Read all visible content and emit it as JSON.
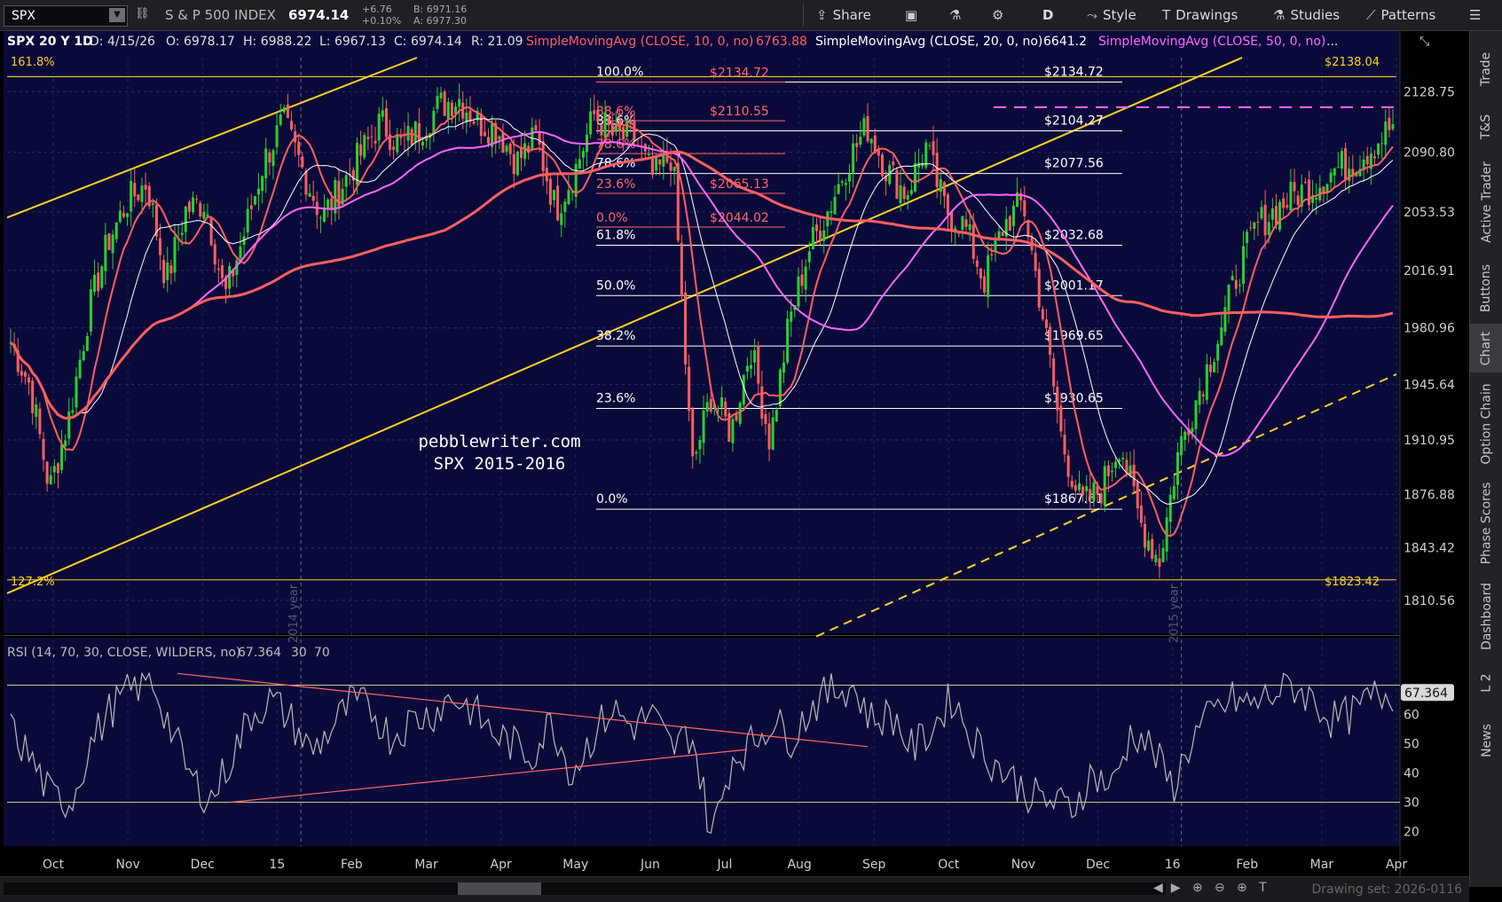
{
  "toolbar": {
    "symbol": "SPX",
    "description": "S & P 500 INDEX",
    "last": "6974.14",
    "change": "+6.76",
    "change_pct": "+0.10%",
    "bid": "B: 6971.16",
    "ask": "A: 6977.30",
    "buttons": {
      "share": "Share",
      "period": "D",
      "style": "Style",
      "drawings": "Drawings",
      "studies": "Studies",
      "patterns": "Patterns"
    }
  },
  "status_line": {
    "title": "SPX 20 Y 1D",
    "date": "D: 4/15/26",
    "open": "O: 6978.17",
    "high": "H: 6988.22",
    "low": "L: 6967.13",
    "close": "C: 6974.14",
    "range": "R: 21.09",
    "sma10_label": "SimpleMovingAvg (CLOSE, 10, 0, no)",
    "sma10_value": "6763.88",
    "sma20_label": "SimpleMovingAvg (CLOSE, 20, 0, no)",
    "sma20_value": "6641.2",
    "sma50_label": "SimpleMovingAvg (CLOSE, 50, 0, no)",
    "more": "..."
  },
  "colors": {
    "background": "#0a0a3a",
    "sma10": "#ff5f5f",
    "sma20": "#ffffff",
    "sma50": "#ff66ff",
    "sma200": "#ff5f5f",
    "channel": "#ffd21f",
    "fib_large": "#ffffff",
    "fib_small": "#ff6666",
    "rsi": "#b9b9b9",
    "up_candle": "#2bd02b",
    "down_candle": "#ff5f5f"
  },
  "chart_data": {
    "type": "candlestick",
    "title": "",
    "watermark": [
      "pebblewriter.com",
      "SPX 2015-2016"
    ],
    "ylim": [
      1790,
      2150
    ],
    "y_ticks": [
      2128.75,
      2090.8,
      2053.53,
      2016.91,
      1980.96,
      1945.64,
      1910.95,
      1876.88,
      1843.42,
      1810.56
    ],
    "x_ticks": [
      "Oct",
      "Nov",
      "Dec",
      "15",
      "Feb",
      "Mar",
      "Apr",
      "May",
      "Jun",
      "Jul",
      "Aug",
      "Sep",
      "Oct",
      "Nov",
      "Dec",
      "16",
      "Feb",
      "Mar",
      "Apr"
    ],
    "year_separators": [
      "2014 year",
      "2015 year"
    ],
    "price_path": [
      1972,
      1945,
      1880,
      1925,
      1990,
      2035,
      2060,
      2072,
      2010,
      2055,
      2060,
      2000,
      2040,
      2085,
      2110,
      2080,
      2050,
      2070,
      2090,
      2110,
      2095,
      2105,
      2120,
      2125,
      2110,
      2105,
      2085,
      2100,
      2055,
      2080,
      2115,
      2100,
      2100,
      2075,
      2090,
      1893,
      1940,
      1915,
      1970,
      1910,
      1985,
      2030,
      2055,
      2085,
      2107,
      2080,
      2065,
      2095,
      2055,
      2045,
      2010,
      2045,
      2060,
      1990,
      1910,
      1870,
      1880,
      1910,
      1860,
      1835,
      1905,
      1940,
      1975,
      2015,
      2045,
      2055,
      2065,
      2070,
      2080,
      2085,
      2095,
      2108
    ],
    "fib_levels_large": [
      {
        "pct": "100.0%",
        "price": "$2134.72"
      },
      {
        "pct": "88.6%",
        "price": "$2104.27"
      },
      {
        "pct": "78.6%",
        "price": "$2077.56"
      },
      {
        "pct": "61.8%",
        "price": "$2032.68"
      },
      {
        "pct": "50.0%",
        "price": "$2001.17"
      },
      {
        "pct": "38.2%",
        "price": "$1969.65"
      },
      {
        "pct": "23.6%",
        "price": "$1930.65"
      },
      {
        "pct": "0.0%",
        "price": "$1867.61"
      }
    ],
    "fib_levels_small": [
      {
        "pct": "100.0%",
        "price": "$2134.72"
      },
      {
        "pct": "88.6%",
        "price": "$2110.55"
      },
      {
        "pct": "78.6%",
        "price": ""
      },
      {
        "pct": "23.6%",
        "price": "$2065.13"
      },
      {
        "pct": "0.0%",
        "price": "$2044.02"
      }
    ],
    "channel_labels": {
      "top_pct": "161.8%",
      "top_price": "$2138.04",
      "bottom_pct": "127.2%",
      "bottom_price": "$1823.42"
    },
    "rsi": {
      "label": "RSI (14, 70, 30, CLOSE, WILDERS, no)",
      "value": "67.364",
      "oversold": "30",
      "overbought": "70",
      "ylim": [
        15,
        75
      ],
      "ticks": [
        20,
        30,
        40,
        50,
        60
      ],
      "path": [
        55,
        45,
        32,
        30,
        50,
        62,
        68,
        73,
        55,
        38,
        31,
        45,
        60,
        65,
        58,
        47,
        55,
        64,
        62,
        52,
        58,
        60,
        66,
        62,
        54,
        50,
        46,
        58,
        40,
        52,
        62,
        56,
        60,
        48,
        54,
        18,
        45,
        50,
        58,
        52,
        63,
        68,
        70,
        58,
        60,
        48,
        55,
        66,
        52,
        44,
        38,
        32,
        30,
        28,
        40,
        35,
        55,
        48,
        35,
        52,
        60,
        65,
        63,
        67,
        70,
        65,
        58,
        60,
        66,
        67.364
      ]
    }
  },
  "sidebar": [
    "Trade",
    "T&S",
    "Active Trader",
    "Buttons",
    "Chart",
    "Option Chain",
    "Phase Scores",
    "Dashboard",
    "L 2",
    "News"
  ],
  "bottom": {
    "drawing_set": "Drawing set: 2026-0116"
  }
}
